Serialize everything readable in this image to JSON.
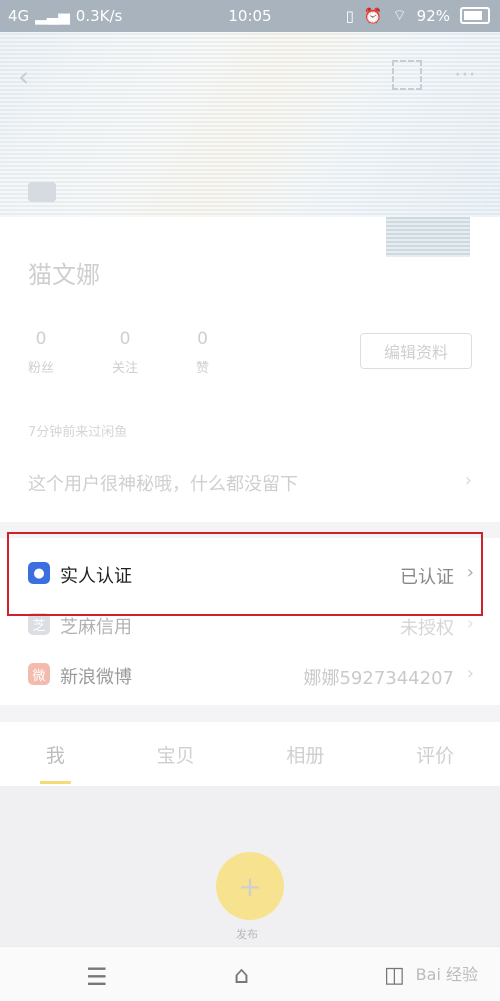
{
  "status_bar": {
    "network": "4G",
    "speed": "0.3K/s",
    "time": "10:05",
    "battery": "92%"
  },
  "profile": {
    "username": "猫文娜",
    "stats": [
      {
        "value": "0",
        "label": "粉丝"
      },
      {
        "value": "0",
        "label": "关注"
      },
      {
        "value": "0",
        "label": "赞"
      }
    ],
    "edit_button": "编辑资料",
    "last_seen": "7分钟前来过闲鱼",
    "bio": "这个用户很神秘哦，什么都没留下"
  },
  "verification": {
    "items": [
      {
        "label": "实人认证",
        "value": "已认证",
        "icon": "person-shield-icon"
      },
      {
        "label": "芝麻信用",
        "value": "未授权",
        "icon": "zhima-icon"
      },
      {
        "label": "新浪微博",
        "value": "娜娜5927344207",
        "icon": "weibo-icon"
      }
    ]
  },
  "tabs": [
    "我",
    "宝贝",
    "相册",
    "评价"
  ],
  "publish": {
    "label": "发布"
  },
  "watermark": "Bai 经验"
}
